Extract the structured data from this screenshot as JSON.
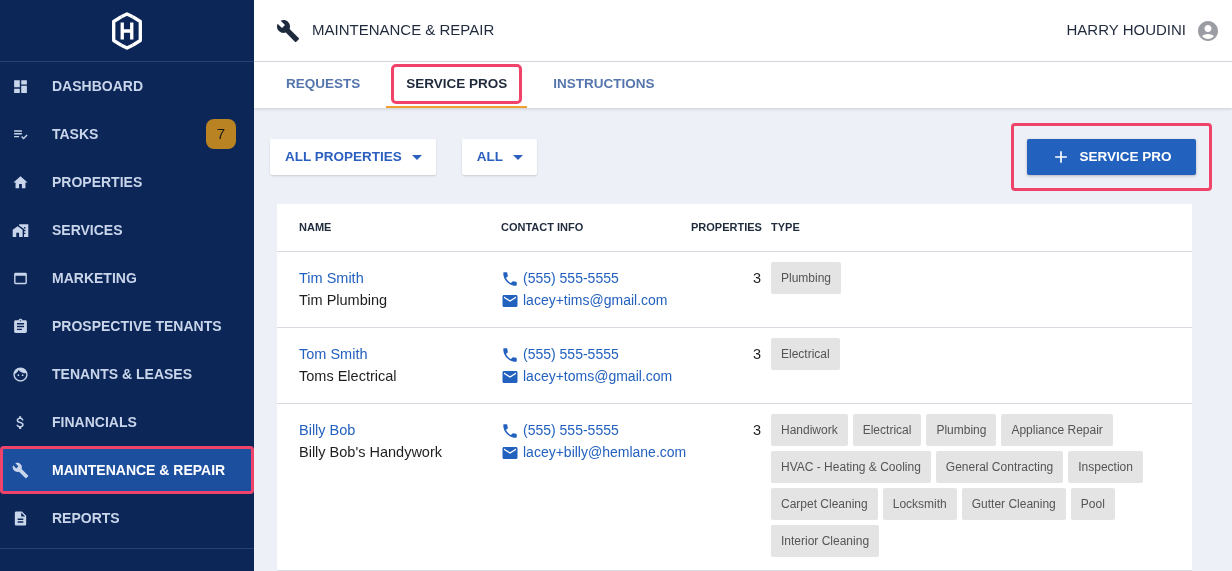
{
  "sidebar": {
    "items": [
      {
        "label": "DASHBOARD",
        "selected": false,
        "highlighted": false
      },
      {
        "label": "TASKS",
        "selected": false,
        "highlighted": false,
        "badge": "7"
      },
      {
        "label": "PROPERTIES",
        "selected": false,
        "highlighted": false
      },
      {
        "label": "SERVICES",
        "selected": false,
        "highlighted": false
      },
      {
        "label": "MARKETING",
        "selected": false,
        "highlighted": false
      },
      {
        "label": "PROSPECTIVE TENANTS",
        "selected": false,
        "highlighted": false
      },
      {
        "label": "TENANTS & LEASES",
        "selected": false,
        "highlighted": false
      },
      {
        "label": "FINANCIALS",
        "selected": false,
        "highlighted": false
      },
      {
        "label": "MAINTENANCE & REPAIR",
        "selected": true,
        "highlighted": true
      },
      {
        "label": "REPORTS",
        "selected": false,
        "highlighted": false
      }
    ]
  },
  "header": {
    "title": "MAINTENANCE & REPAIR",
    "user": "HARRY HOUDINI"
  },
  "tabs": [
    {
      "label": "REQUESTS",
      "selected": false,
      "highlighted": false
    },
    {
      "label": "SERVICE PROS",
      "selected": true,
      "highlighted": true
    },
    {
      "label": "INSTRUCTIONS",
      "selected": false,
      "highlighted": false
    }
  ],
  "filters": [
    {
      "label": "ALL PROPERTIES"
    },
    {
      "label": "ALL"
    }
  ],
  "add_button": {
    "label": "SERVICE PRO",
    "highlighted": true
  },
  "table": {
    "columns": [
      "NAME",
      "CONTACT INFO",
      "PROPERTIES",
      "TYPE"
    ],
    "rows": [
      {
        "name": "Tim Smith",
        "company": "Tim Plumbing",
        "phone": "(555) 555-5555",
        "email": "lacey+tims@gmail.com",
        "properties": "3",
        "types": [
          "Plumbing"
        ]
      },
      {
        "name": "Tom Smith",
        "company": "Toms Electrical",
        "phone": "(555) 555-5555",
        "email": "lacey+toms@gmail.com",
        "properties": "3",
        "types": [
          "Electrical"
        ]
      },
      {
        "name": "Billy Bob",
        "company": "Billy Bob's Handywork",
        "phone": "(555) 555-5555",
        "email": "lacey+billy@hemlane.com",
        "properties": "3",
        "types": [
          "Handiwork",
          "Electrical",
          "Plumbing",
          "Appliance Repair",
          "HVAC - Heating & Cooling",
          "General Contracting",
          "Inspection",
          "Carpet Cleaning",
          "Locksmith",
          "Gutter Cleaning",
          "Pool",
          "Interior Cleaning"
        ]
      }
    ]
  }
}
